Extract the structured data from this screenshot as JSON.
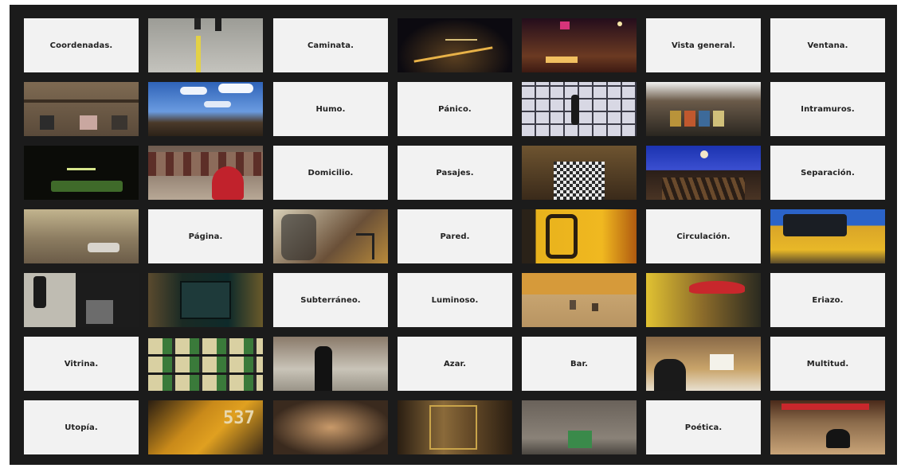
{
  "grid": {
    "rows": [
      [
        {
          "type": "label",
          "text": "Coordenadas."
        },
        {
          "type": "photo",
          "name": "street-legs-photo"
        },
        {
          "type": "label",
          "text": "Caminata."
        },
        {
          "type": "photo",
          "name": "night-city-photo"
        },
        {
          "type": "photo",
          "name": "night-avenue-photo"
        },
        {
          "type": "label",
          "text": "Vista general."
        },
        {
          "type": "label",
          "text": "Ventana."
        }
      ],
      [
        {
          "type": "photo",
          "name": "building-facade-photo"
        },
        {
          "type": "photo",
          "name": "city-sky-photo"
        },
        {
          "type": "label",
          "text": "Humo."
        },
        {
          "type": "label",
          "text": "Pánico."
        },
        {
          "type": "photo",
          "name": "glass-ceiling-photo"
        },
        {
          "type": "photo",
          "name": "posters-street-photo"
        },
        {
          "type": "label",
          "text": "Intramuros."
        }
      ],
      [
        {
          "type": "photo",
          "name": "billiard-room-photo"
        },
        {
          "type": "photo",
          "name": "red-hair-street-photo"
        },
        {
          "type": "label",
          "text": "Domicilio."
        },
        {
          "type": "label",
          "text": "Pasajes."
        },
        {
          "type": "photo",
          "name": "checkered-passage-photo"
        },
        {
          "type": "photo",
          "name": "station-roof-photo"
        },
        {
          "type": "label",
          "text": "Separación."
        }
      ],
      [
        {
          "type": "photo",
          "name": "wall-sleeper-photo"
        },
        {
          "type": "label",
          "text": "Página."
        },
        {
          "type": "photo",
          "name": "graffiti-wall-photo"
        },
        {
          "type": "label",
          "text": "Pared."
        },
        {
          "type": "photo",
          "name": "yellow-bus-number-photo"
        },
        {
          "type": "label",
          "text": "Circulación."
        },
        {
          "type": "photo",
          "name": "yellow-bus-photo"
        }
      ],
      [
        {
          "type": "photo",
          "name": "walking-feet-photo"
        },
        {
          "type": "photo",
          "name": "subway-poster-photo"
        },
        {
          "type": "label",
          "text": "Subterráneo."
        },
        {
          "type": "label",
          "text": "Luminoso."
        },
        {
          "type": "photo",
          "name": "plaza-pigeons-photo"
        },
        {
          "type": "photo",
          "name": "red-umbrella-blur-photo"
        },
        {
          "type": "label",
          "text": "Eriazo."
        }
      ],
      [
        {
          "type": "label",
          "text": "Vitrina."
        },
        {
          "type": "photo",
          "name": "gloves-display-photo"
        },
        {
          "type": "photo",
          "name": "man-coat-street-photo"
        },
        {
          "type": "label",
          "text": "Azar."
        },
        {
          "type": "label",
          "text": "Bar."
        },
        {
          "type": "photo",
          "name": "bar-counter-photo"
        },
        {
          "type": "label",
          "text": "Multitud."
        }
      ],
      [
        {
          "type": "label",
          "text": "Utopía."
        },
        {
          "type": "photo",
          "name": "ticket-537-photo",
          "overlay": "537"
        },
        {
          "type": "photo",
          "name": "blurred-figure-photo"
        },
        {
          "type": "photo",
          "name": "ornate-door-photo"
        },
        {
          "type": "photo",
          "name": "green-bin-wall-photo"
        },
        {
          "type": "label",
          "text": "Poética."
        },
        {
          "type": "photo",
          "name": "fruit-crates-dog-photo"
        }
      ]
    ]
  },
  "colors": {
    "board": "#1b1b1b",
    "label_bg": "#f2f2f2",
    "label_text": "#222222",
    "accent_yellow": "#e8b21c",
    "accent_red": "#c8272c"
  }
}
